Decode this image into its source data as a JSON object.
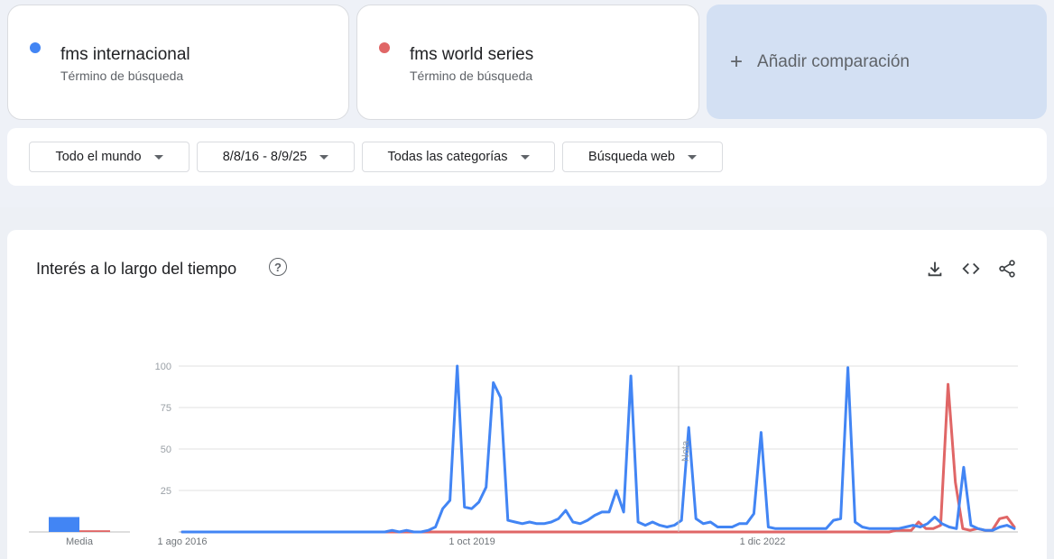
{
  "terms": [
    {
      "name": "fms internacional",
      "subtitle": "Término de búsqueda",
      "color": "#4285f4"
    },
    {
      "name": "fms world series",
      "subtitle": "Término de búsqueda",
      "color": "#e06666"
    }
  ],
  "add_comparison": {
    "icon": "plus-icon",
    "label": "Añadir comparación"
  },
  "filters": {
    "region": "Todo el mundo",
    "date_range": "8/8/16 - 8/9/25",
    "category": "Todas las categorías",
    "search_type": "Búsqueda web"
  },
  "panel": {
    "title": "Interés a lo largo del tiempo",
    "help_icon": "help-circle-icon",
    "tools": [
      "download-icon",
      "embed-code-icon",
      "share-icon"
    ]
  },
  "average": {
    "label": "Media",
    "values": [
      9,
      1
    ]
  },
  "chart_data": {
    "type": "line",
    "x_tick_labels": [
      "1 ago 2016",
      "1 oct 2019",
      "1 dic 2022"
    ],
    "y_tick_labels": [
      "100",
      "75",
      "50",
      "25"
    ],
    "ylim": [
      0,
      100
    ],
    "grid": true,
    "annotation": "Nota",
    "series": [
      {
        "name": "fms internacional",
        "color": "#4285f4",
        "values": [
          0,
          0,
          0,
          0,
          0,
          0,
          0,
          0,
          0,
          0,
          0,
          0,
          0,
          0,
          0,
          0,
          0,
          0,
          0,
          0,
          0,
          0,
          0,
          0,
          0,
          0,
          0,
          0,
          0,
          1,
          0,
          1,
          0,
          0,
          1,
          3,
          14,
          19,
          100,
          15,
          14,
          18,
          27,
          90,
          81,
          7,
          6,
          5,
          6,
          5,
          5,
          6,
          8,
          13,
          6,
          5,
          7,
          10,
          12,
          12,
          25,
          12,
          94,
          6,
          4,
          6,
          4,
          3,
          4,
          7,
          63,
          8,
          5,
          6,
          3,
          3,
          3,
          5,
          5,
          11,
          60,
          3,
          2,
          2,
          2,
          2,
          2,
          2,
          2,
          2,
          7,
          8,
          99,
          6,
          3,
          2,
          2,
          2,
          2,
          2,
          3,
          4,
          3,
          5,
          9,
          5,
          3,
          2,
          39,
          4,
          2,
          1,
          1,
          3,
          4,
          2
        ]
      },
      {
        "name": "fms world series",
        "color": "#e06666",
        "values": [
          0,
          0,
          0,
          0,
          0,
          0,
          0,
          0,
          0,
          0,
          0,
          0,
          0,
          0,
          0,
          0,
          0,
          0,
          0,
          0,
          0,
          0,
          0,
          0,
          0,
          0,
          0,
          0,
          0,
          0,
          0,
          0,
          0,
          0,
          0,
          0,
          0,
          0,
          0,
          0,
          0,
          0,
          0,
          0,
          0,
          0,
          0,
          0,
          0,
          0,
          0,
          0,
          0,
          0,
          0,
          0,
          0,
          0,
          0,
          0,
          0,
          0,
          0,
          0,
          0,
          0,
          0,
          0,
          0,
          0,
          0,
          0,
          0,
          0,
          0,
          0,
          0,
          0,
          0,
          0,
          0,
          0,
          0,
          0,
          0,
          0,
          0,
          0,
          0,
          0,
          0,
          0,
          0,
          0,
          0,
          0,
          0,
          1,
          1,
          1,
          6,
          2,
          2,
          4,
          89,
          30,
          2,
          1,
          2,
          1,
          1,
          8,
          9,
          3
        ]
      }
    ]
  }
}
